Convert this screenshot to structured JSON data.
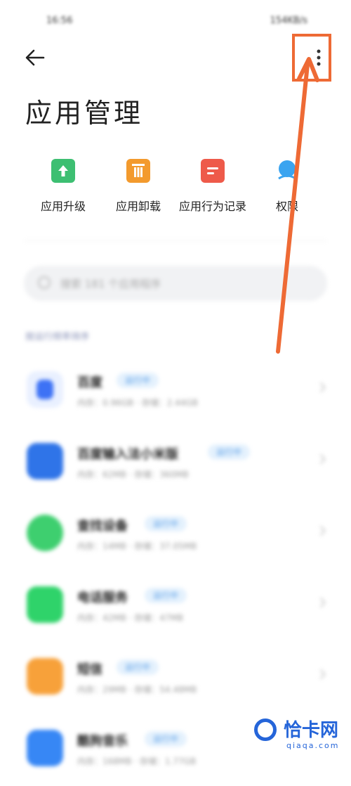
{
  "status_bar": {
    "time": "16:56",
    "right": "154KB/s"
  },
  "header": {
    "title": "应用管理"
  },
  "toolbar": [
    {
      "label": "应用升级",
      "icon": "upgrade-icon",
      "color": "#3dbf72"
    },
    {
      "label": "应用卸载",
      "icon": "trash-icon",
      "color": "#f39a2d"
    },
    {
      "label": "应用行为记录",
      "icon": "record-icon",
      "color": "#ee5a4a"
    },
    {
      "label": "权限",
      "icon": "permission-icon",
      "color": "#3aa4f0"
    }
  ],
  "search": {
    "placeholder": "搜索 181 个应用程序"
  },
  "sort_label": "按运行频率排序",
  "apps": [
    {
      "name": "百度",
      "tag": "运行中",
      "meta": "内存：0.96GB · 存储：2.44GB",
      "color": "#3d72f5"
    },
    {
      "name": "百度输入法小米版",
      "tag": "运行中",
      "meta": "内存：62MB · 存储：360MB",
      "color": "#2f74e8"
    },
    {
      "name": "查找设备",
      "tag": "运行中",
      "meta": "内存：14MB · 存储：37.05MB",
      "color": "#3ecf6f"
    },
    {
      "name": "电话服务",
      "tag": "运行中",
      "meta": "内存：42MB · 存储：47MB",
      "color": "#2fd36a"
    },
    {
      "name": "短信",
      "tag": "运行中",
      "meta": "内存：29MB · 存储：54.48MB",
      "color": "#f7a13a"
    },
    {
      "name": "酷狗音乐",
      "tag": "运行中",
      "meta": "内存：168MB · 存储：1.77GB",
      "color": "#3787f5"
    }
  ],
  "watermark": {
    "name": "恰卡网",
    "domain": "qiaqa.com"
  },
  "annotation_color": "#ee6a35"
}
